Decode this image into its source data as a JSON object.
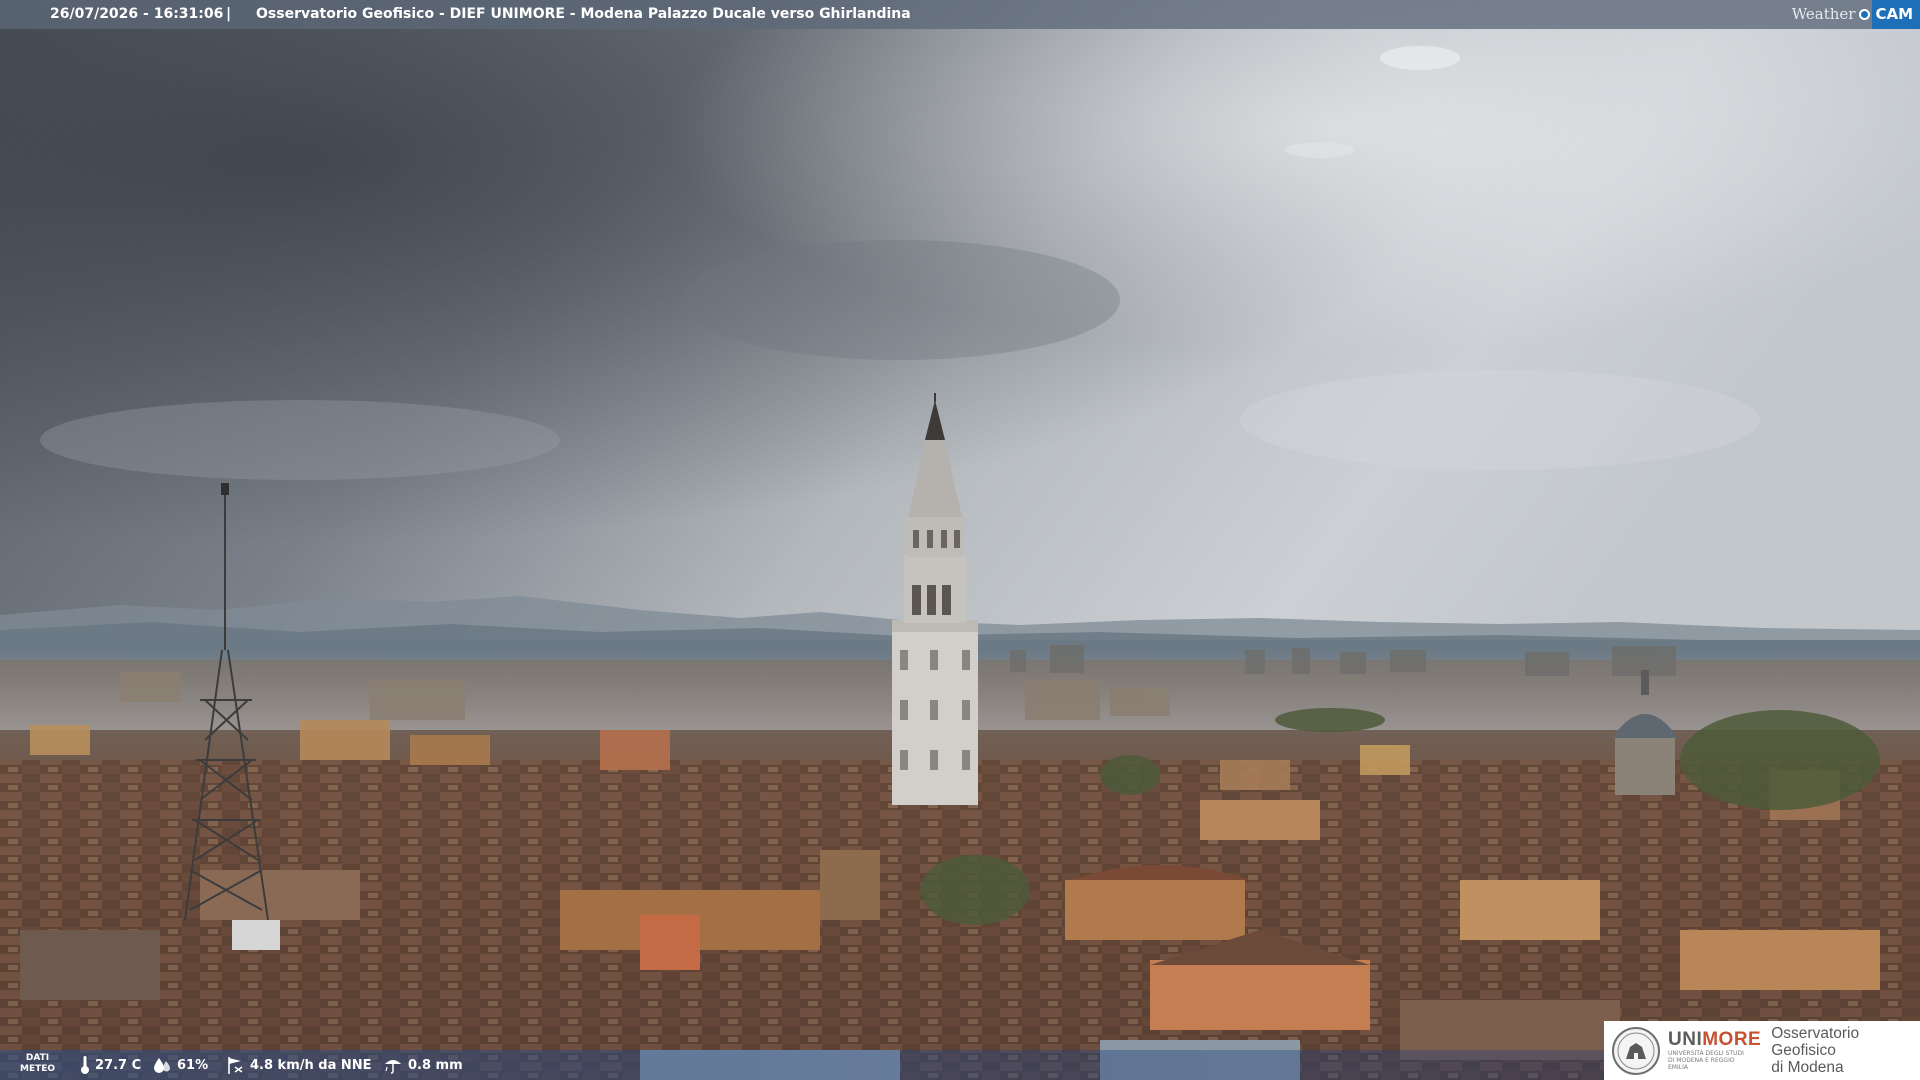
{
  "header": {
    "timestamp": "26/07/2026 - 16:31:06",
    "separator": "|",
    "title": "Osservatorio Geofisico - DIEF UNIMORE - Modena Palazzo Ducale verso Ghirlandina"
  },
  "weathercam_logo": {
    "weather_text": "Weather",
    "cam_text": "CAM",
    "accent_color": "#1d6fb8"
  },
  "weather_data": {
    "label_line1": "DATI",
    "label_line2": "METEO",
    "temperature": "27.7 C",
    "humidity": "61%",
    "wind": "4.8 km/h da NNE",
    "rain": "0.8 mm",
    "icons": [
      "thermometer-icon",
      "humidity-drop-icon",
      "wind-icon",
      "rain-gauge-icon"
    ]
  },
  "institution_logo": {
    "unimore_prefix": "UNI",
    "unimore_suffix": "MORE",
    "unimore_subtitle": "UNIVERSITÀ DEGLI STUDI DI MODENA E REGGIO EMILIA",
    "observatory_line1": "Osservatorio Geofisico",
    "observatory_line2": "di Modena",
    "brand_red": "#c8512f",
    "brand_grey": "#5d5d5d"
  }
}
